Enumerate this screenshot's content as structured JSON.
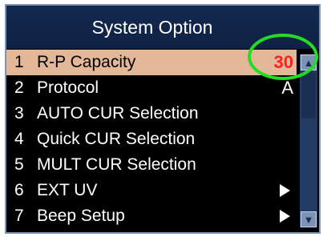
{
  "window": {
    "title": "System Option"
  },
  "menu": {
    "items": [
      {
        "num": "1",
        "label": "R-P Capacity",
        "value": "30"
      },
      {
        "num": "2",
        "label": "Protocol",
        "value": "A"
      },
      {
        "num": "3",
        "label": "AUTO CUR Selection",
        "value": ""
      },
      {
        "num": "4",
        "label": "Quick CUR Selection",
        "value": ""
      },
      {
        "num": "5",
        "label": "MULT CUR Selection",
        "value": ""
      },
      {
        "num": "6",
        "label": "EXT UV",
        "value": ""
      },
      {
        "num": "7",
        "label": "Beep Setup",
        "value": ""
      }
    ],
    "selected_index": 0,
    "submenu_items": [
      6,
      7
    ]
  },
  "scrollbar": {
    "up_icon": "chevron-up-icon",
    "down_icon": "chevron-down-icon"
  },
  "colors": {
    "title_bg": "#13294d",
    "selected_bg": "#e3b898",
    "selected_value": "#ff1f1f",
    "highlight_ring": "#22dd22",
    "scrollbar_track": "#233c63",
    "scrollbar_button": "#7c93b5"
  }
}
